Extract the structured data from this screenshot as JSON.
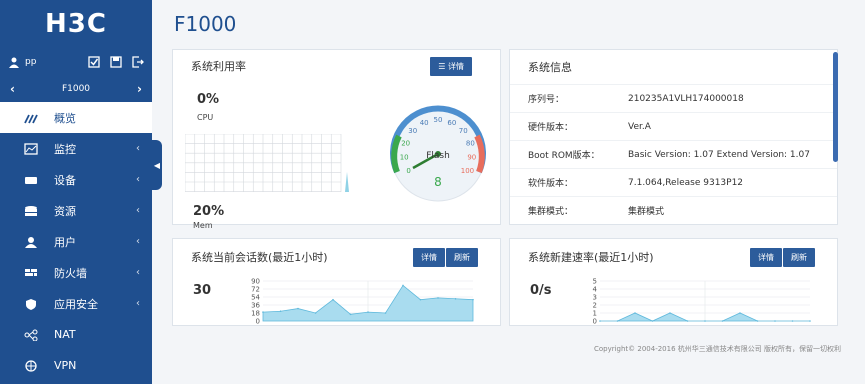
{
  "brand": {
    "logo": "H3C"
  },
  "user": {
    "name": "pp"
  },
  "device": {
    "name": "F1000"
  },
  "menu": [
    {
      "label": "概览",
      "icon": "dashboard-icon",
      "active": true
    },
    {
      "label": "监控",
      "icon": "monitor-icon"
    },
    {
      "label": "设备",
      "icon": "device-icon"
    },
    {
      "label": "资源",
      "icon": "database-icon"
    },
    {
      "label": "用户",
      "icon": "user-icon"
    },
    {
      "label": "防火墙",
      "icon": "firewall-icon"
    },
    {
      "label": "应用安全",
      "icon": "shield-icon"
    },
    {
      "label": "NAT",
      "icon": "nat-icon"
    },
    {
      "label": "VPN",
      "icon": "vpn-icon"
    }
  ],
  "page": {
    "title": "F1000"
  },
  "util": {
    "title": "系统利用率",
    "details_btn": "详情",
    "cpu_value": "0%",
    "cpu_label": "CPU",
    "mem_value": "20%",
    "mem_label": "Mem",
    "flash_label": "Flash",
    "flash_value": "8",
    "gauge_ticks": [
      "0",
      "10",
      "20",
      "30",
      "40",
      "50",
      "60",
      "70",
      "80",
      "90",
      "100"
    ]
  },
  "sysinfo": {
    "title": "系统信息",
    "rows": [
      {
        "k": "序列号：",
        "v": "210235A1VLH174000018"
      },
      {
        "k": "硬件版本：",
        "v": "Ver.A"
      },
      {
        "k": "Boot ROM版本：",
        "v": "Basic Version: 1.07 Extend Version: 1.07"
      },
      {
        "k": "软件版本：",
        "v": "7.1.064,Release 9313P12"
      },
      {
        "k": "集群模式：",
        "v": "集群模式"
      }
    ]
  },
  "sessions": {
    "title": "系统当前会话数(最近1小时)",
    "details_btn": "详情",
    "refresh_btn": "刷新",
    "value": "30",
    "y_ticks": [
      "90",
      "72",
      "54",
      "36",
      "18",
      "0"
    ]
  },
  "newrate": {
    "title": "系统新建速率(最近1小时)",
    "details_btn": "详情",
    "refresh_btn": "刷新",
    "value": "0/s",
    "y_ticks": [
      "5",
      "4",
      "3",
      "2",
      "1",
      "0"
    ]
  },
  "footer": {
    "text": "Copyright© 2004-2016 杭州华三通信技术有限公司 版权所有，保留一切权利"
  },
  "chart_data": [
    {
      "type": "area",
      "title": "系统当前会话数(最近1小时)",
      "ylim": [
        0,
        90
      ],
      "x": [
        0,
        1,
        2,
        3,
        4,
        5,
        6,
        7,
        8,
        9,
        10,
        11,
        12
      ],
      "series": [
        {
          "values": [
            20,
            22,
            28,
            18,
            48,
            15,
            20,
            18,
            80,
            48,
            52,
            50,
            48
          ]
        }
      ]
    },
    {
      "type": "area",
      "title": "系统新建速率(最近1小时)",
      "ylim": [
        0,
        5
      ],
      "x": [
        0,
        1,
        2,
        3,
        4,
        5,
        6,
        7,
        8,
        9,
        10,
        11,
        12
      ],
      "series": [
        {
          "values": [
            0,
            0,
            1,
            0,
            1,
            0,
            0,
            0,
            1,
            0,
            0,
            0,
            0
          ]
        }
      ]
    }
  ]
}
